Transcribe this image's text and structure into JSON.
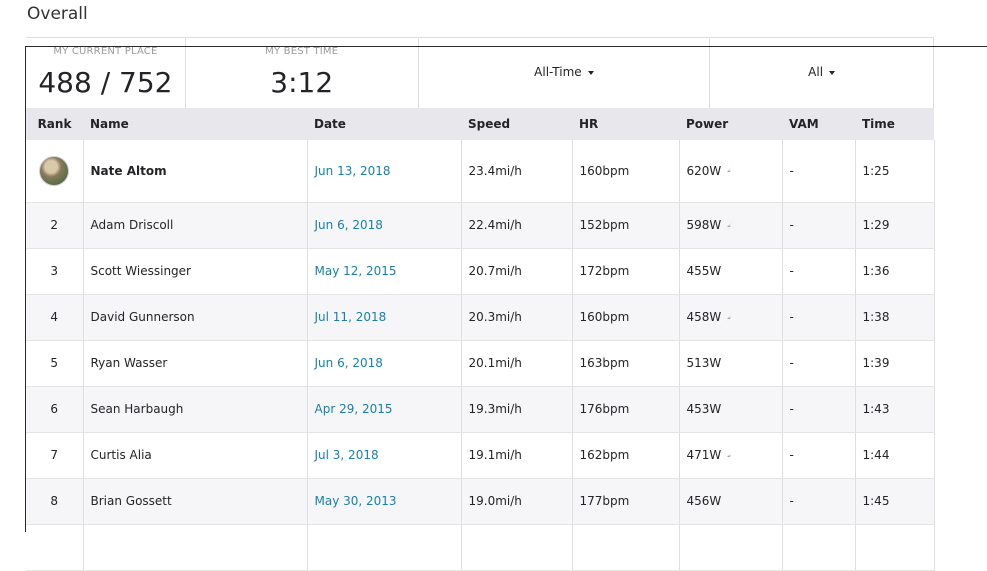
{
  "section_title": "Overall",
  "stats": {
    "current_place_label": "MY CURRENT PLACE",
    "current_place_value": "488 / 752",
    "best_time_label": "MY BEST TIME",
    "best_time_value": "3:12",
    "time_filter": "All-Time",
    "group_filter": "All"
  },
  "table": {
    "headers": {
      "rank": "Rank",
      "name": "Name",
      "date": "Date",
      "speed": "Speed",
      "hr": "HR",
      "power": "Power",
      "vam": "VAM",
      "time": "Time"
    },
    "rows": [
      {
        "rank": "",
        "name": "Nate Altom",
        "date": "Jun 13, 2018",
        "speed": "23.4mi/h",
        "hr": "160bpm",
        "power": "620W",
        "vam": "-",
        "time": "1:25"
      },
      {
        "rank": "2",
        "name": "Adam Driscoll",
        "date": "Jun 6, 2018",
        "speed": "22.4mi/h",
        "hr": "152bpm",
        "power": "598W",
        "vam": "-",
        "time": "1:29"
      },
      {
        "rank": "3",
        "name": "Scott Wiessinger",
        "date": "May 12, 2015",
        "speed": "20.7mi/h",
        "hr": "172bpm",
        "power": "455W",
        "vam": "-",
        "time": "1:36"
      },
      {
        "rank": "4",
        "name": "David Gunnerson",
        "date": "Jul 11, 2018",
        "speed": "20.3mi/h",
        "hr": "160bpm",
        "power": "458W",
        "vam": "-",
        "time": "1:38"
      },
      {
        "rank": "5",
        "name": "Ryan Wasser",
        "date": "Jun 6, 2018",
        "speed": "20.1mi/h",
        "hr": "163bpm",
        "power": "513W",
        "vam": "-",
        "time": "1:39"
      },
      {
        "rank": "6",
        "name": "Sean Harbaugh",
        "date": "Apr 29, 2015",
        "speed": "19.3mi/h",
        "hr": "176bpm",
        "power": "453W",
        "vam": "-",
        "time": "1:43"
      },
      {
        "rank": "7",
        "name": "Curtis Alia",
        "date": "Jul 3, 2018",
        "speed": "19.1mi/h",
        "hr": "162bpm",
        "power": "471W",
        "vam": "-",
        "time": "1:44"
      },
      {
        "rank": "8",
        "name": "Brian Gossett",
        "date": "May 30, 2013",
        "speed": "19.0mi/h",
        "hr": "177bpm",
        "power": "456W",
        "vam": "-",
        "time": "1:45"
      }
    ]
  }
}
